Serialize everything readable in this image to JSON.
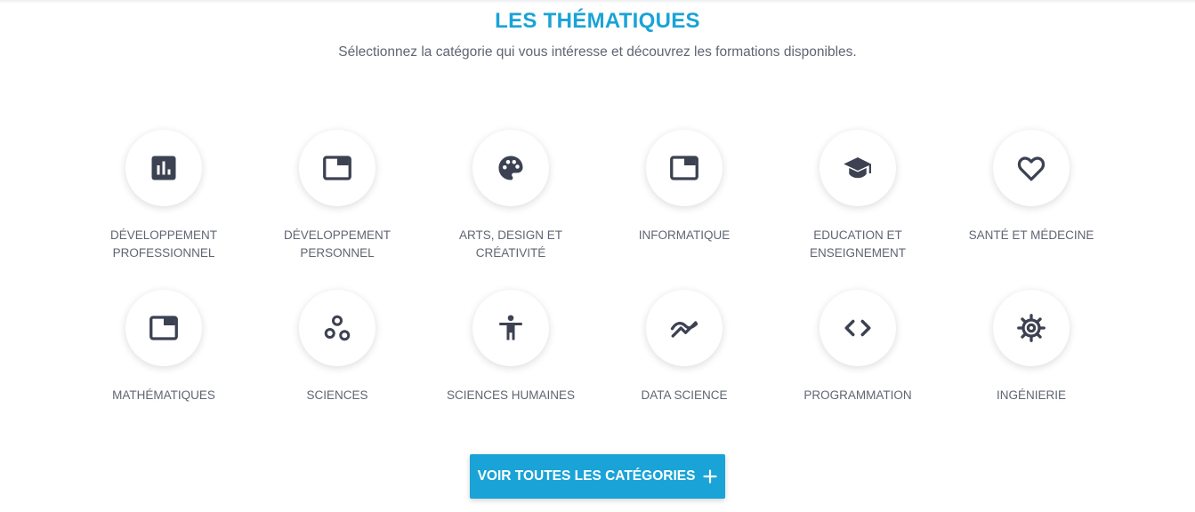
{
  "header": {
    "title": "LES THÉMATIQUES",
    "subtitle": "Sélectionnez la catégorie qui vous intéresse et découvrez les formations disponibles."
  },
  "categories": [
    {
      "label": "DÉVELOPPEMENT PROFESSIONNEL",
      "icon": "bar-chart-icon"
    },
    {
      "label": "DÉVELOPPEMENT PERSONNEL",
      "icon": "window-icon"
    },
    {
      "label": "ARTS, DESIGN ET CRÉATIVITÉ",
      "icon": "palette-icon"
    },
    {
      "label": "INFORMATIQUE",
      "icon": "window-icon"
    },
    {
      "label": "EDUCATION ET ENSEIGNEMENT",
      "icon": "graduation-cap-icon"
    },
    {
      "label": "SANTÉ ET MÉDECINE",
      "icon": "heart-icon"
    },
    {
      "label": "MATHÉMATIQUES",
      "icon": "window-icon"
    },
    {
      "label": "SCIENCES",
      "icon": "atoms-icon"
    },
    {
      "label": "SCIENCES HUMAINES",
      "icon": "human-icon"
    },
    {
      "label": "DATA SCIENCE",
      "icon": "trend-icon"
    },
    {
      "label": "PROGRAMMATION",
      "icon": "code-icon"
    },
    {
      "label": "INGÉNIERIE",
      "icon": "gear-icon"
    }
  ],
  "button": {
    "label": "VOIR TOUTES LES CATÉGORIES",
    "icon": "plus-icon"
  },
  "colors": {
    "accent": "#1aa3d6",
    "icon": "#3d4252",
    "text": "#5f6572"
  }
}
